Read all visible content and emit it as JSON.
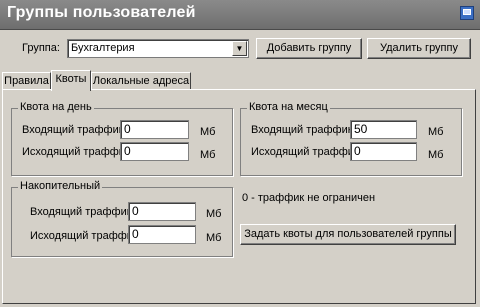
{
  "window": {
    "title": "Группы пользователей",
    "icon": "window-icon"
  },
  "group_selector": {
    "label": "Группа:",
    "selected": "Бухгалтерия"
  },
  "buttons": {
    "add": "Добавить группу",
    "delete": "Удалить группу",
    "set_quotas": "Задать квоты для пользователей группы"
  },
  "tabs": [
    {
      "label": "Правила",
      "active": false
    },
    {
      "label": "Квоты",
      "active": true
    },
    {
      "label": "Локальные адреса",
      "active": false
    }
  ],
  "quota_day": {
    "title": "Квота на день",
    "incoming_label": "Входящий траффик",
    "incoming_value": "0",
    "incoming_unit": "Мб",
    "outgoing_label": "Исходящий траффик",
    "outgoing_value": "0",
    "outgoing_unit": "Мб"
  },
  "quota_month": {
    "title": "Квота на месяц",
    "incoming_label": "Входящий траффик",
    "incoming_value": "50",
    "incoming_unit": "Мб",
    "outgoing_label": "Исходящий траффик",
    "outgoing_value": "0",
    "outgoing_unit": "Мб"
  },
  "cumulative": {
    "title": "Накопительный",
    "incoming_label": "Входящий траффик",
    "incoming_value": "0",
    "incoming_unit": "Мб",
    "outgoing_label": "Исходящий траффик",
    "outgoing_value": "0",
    "outgoing_unit": "Мб"
  },
  "note": "0 - траффик не ограничен"
}
